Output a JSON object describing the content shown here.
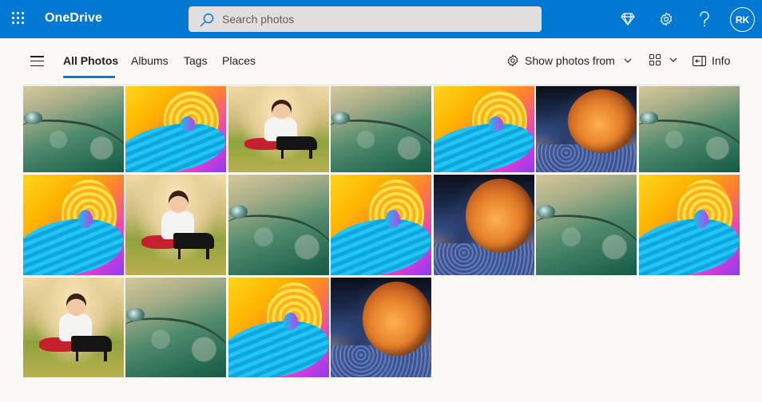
{
  "header": {
    "app_name": "OneDrive",
    "search": {
      "placeholder": "Search photos",
      "value": ""
    },
    "icons": [
      "app-launcher-icon",
      "premium-diamond-icon",
      "settings-gear-icon",
      "help-icon"
    ],
    "avatar_initials": "RK",
    "brand_color": "#0078d4"
  },
  "nav": {
    "tabs": [
      {
        "label": "All Photos",
        "active": true
      },
      {
        "label": "Albums",
        "active": false
      },
      {
        "label": "Tags",
        "active": false
      },
      {
        "label": "Places",
        "active": false
      }
    ],
    "commands": {
      "show_photos_from": "Show photos from",
      "info": "Info"
    }
  },
  "photos": {
    "rows": [
      [
        "water-droplet",
        "rainbow-swirl",
        "child-with-piano",
        "water-droplet",
        "rainbow-swirl",
        "frozen-bubble",
        "water-droplet"
      ],
      [
        "rainbow-swirl",
        "child-with-piano",
        "water-droplet",
        "rainbow-swirl",
        "frozen-bubble",
        "water-droplet",
        "rainbow-swirl"
      ],
      [
        "child-with-piano",
        "water-droplet",
        "rainbow-swirl",
        "frozen-bubble"
      ]
    ]
  }
}
